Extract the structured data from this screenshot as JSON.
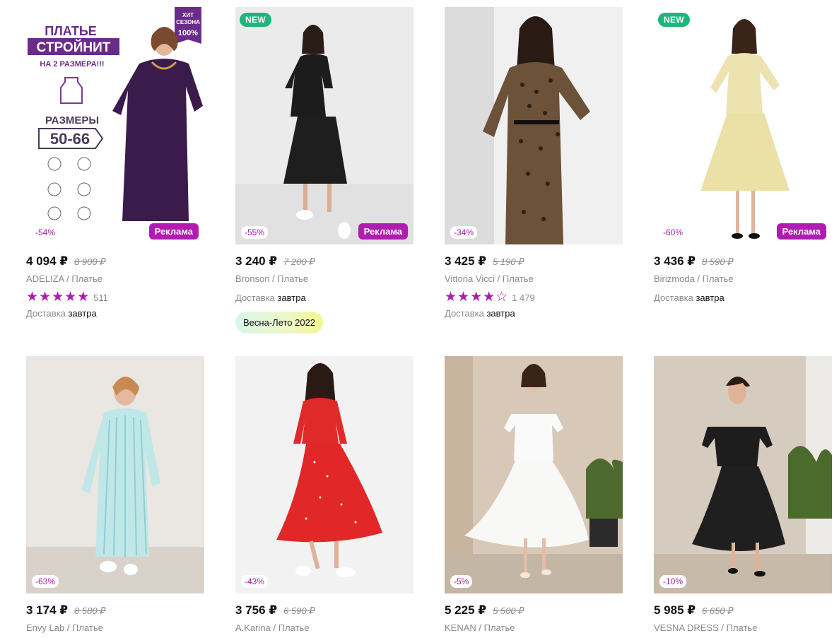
{
  "currency": "₽",
  "products": [
    {
      "badge_new": "",
      "discount": "-54%",
      "ad": "Реклама",
      "price": "4 094 ₽",
      "old_price": "8 900 ₽",
      "brand": "ADELIZA",
      "category": "Платье",
      "stars": "★★★★★",
      "rating_count": "511",
      "delivery_label": "Доставка",
      "delivery_when": "завтра",
      "season": "",
      "promo": {
        "line1": "ПЛАТЬЕ",
        "line2": "СТРОЙНИТ",
        "line3": "НА 2 РАЗМЕРА!!!",
        "sizes_label": "РАЗМЕРЫ",
        "sizes": "50-66",
        "hit_line1": "ХИТ",
        "hit_line2": "СЕЗОНА",
        "hit_pct": "100%"
      }
    },
    {
      "badge_new": "NEW",
      "discount": "-55%",
      "ad": "Реклама",
      "price": "3 240 ₽",
      "old_price": "7 200 ₽",
      "brand": "Bronson",
      "category": "Платье",
      "stars": "",
      "rating_count": "",
      "delivery_label": "Доставка",
      "delivery_when": "завтра",
      "season": "Весна-Лето 2022"
    },
    {
      "badge_new": "",
      "discount": "-34%",
      "ad": "",
      "price": "3 425 ₽",
      "old_price": "5 190 ₽",
      "brand": "Vittoria Vicci",
      "category": "Платье",
      "stars": "★★★★☆",
      "rating_count": "1 479",
      "delivery_label": "Доставка",
      "delivery_when": "завтра",
      "season": ""
    },
    {
      "badge_new": "NEW",
      "discount": "-60%",
      "ad": "Реклама",
      "price": "3 436 ₽",
      "old_price": "8 590 ₽",
      "brand": "Birizmoda",
      "category": "Платье",
      "stars": "",
      "rating_count": "",
      "delivery_label": "Доставка",
      "delivery_when": "завтра",
      "season": ""
    },
    {
      "badge_new": "",
      "discount": "-63%",
      "ad": "",
      "price": "3 174 ₽",
      "old_price": "8 580 ₽",
      "brand": "Envy Lab",
      "category": "Платье",
      "stars": "",
      "rating_count": "",
      "delivery_label": "",
      "delivery_when": "",
      "season": ""
    },
    {
      "badge_new": "",
      "discount": "-43%",
      "ad": "",
      "price": "3 756 ₽",
      "old_price": "6 590 ₽",
      "brand": "A.Karina",
      "category": "Платье",
      "stars": "",
      "rating_count": "",
      "delivery_label": "",
      "delivery_when": "",
      "season": ""
    },
    {
      "badge_new": "",
      "discount": "-5%",
      "ad": "",
      "price": "5 225 ₽",
      "old_price": "5 500 ₽",
      "brand": "KENAN",
      "category": "Платье",
      "stars": "",
      "rating_count": "",
      "delivery_label": "",
      "delivery_when": "",
      "season": ""
    },
    {
      "badge_new": "",
      "discount": "-10%",
      "ad": "",
      "price": "5 985 ₽",
      "old_price": "6 650 ₽",
      "brand": "VESNA DRESS",
      "category": "Платье",
      "stars": "",
      "rating_count": "",
      "delivery_label": "",
      "delivery_when": "",
      "season": ""
    }
  ],
  "colors": {
    "accent": "#b01cb0",
    "new_badge": "#1fb57b",
    "discount_text": "#a21ca6"
  }
}
